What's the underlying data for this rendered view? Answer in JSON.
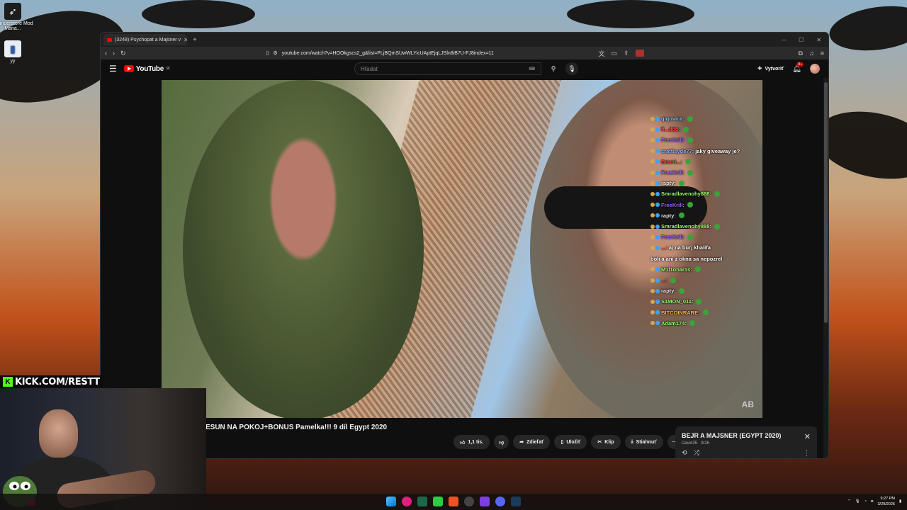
{
  "desktop": {
    "icons": [
      {
        "label": "Thunderstore Mod Mana..."
      },
      {
        "label": "yy"
      }
    ]
  },
  "browser": {
    "tab_title": "(3248) Psychopat a Majsner v",
    "address": "youtube.com/watch?v=HOOkgscs2_g&list=PLjBQmSUwWLYicUAptEjqLJSln8iB7U-FJ8index=11"
  },
  "youtube": {
    "logo_text": "YouTube",
    "logo_sup": "SK",
    "search_placeholder": "Hľadať",
    "create_label": "Vytvoriť",
    "notification_count": "9+",
    "video_title": "ESUN NA POKOJ+BONUS Pamelka!!! 9 díl Egypt 2020",
    "actions": {
      "like_count": "1,1 tis.",
      "share_label": "Zdieľať",
      "save_label": "Uložiť",
      "clip_label": "Klip",
      "download_label": "Stiahnuť"
    },
    "playlist": {
      "title": "BEJR A MAJSNER (EGYPT 2020)",
      "subtitle": "David35 · 9/26"
    },
    "watermark": "AB"
  },
  "chat": [
    {
      "user": "qiqovica:",
      "color": "#7ec8ff",
      "msg": ""
    },
    {
      "user": "fi...ddo:",
      "color": "#ff4040",
      "msg": ""
    },
    {
      "user": "FreeKrill:",
      "color": "#9b6bff",
      "msg": ""
    },
    {
      "user": "crattisyde77:",
      "color": "#8ab4ff",
      "msg": "jaky giveaway je?"
    },
    {
      "user": "Bmeri...:",
      "color": "#ff4040",
      "msg": ""
    },
    {
      "user": "FreeKrill:",
      "color": "#9b6bff",
      "msg": ""
    },
    {
      "user": "rapty:",
      "color": "#e8e8e8",
      "msg": ""
    },
    {
      "user": "Smradlavenohy888:",
      "color": "#9dff6a",
      "msg": ""
    },
    {
      "user": "FreeKrill:",
      "color": "#9b6bff",
      "msg": ""
    },
    {
      "user": "rapty:",
      "color": "#e8e8e8",
      "msg": ""
    },
    {
      "user": "Smradlavenohy888:",
      "color": "#9dff6a",
      "msg": ""
    },
    {
      "user": "FreeKrill:",
      "color": "#9b6bff",
      "msg": ""
    },
    {
      "user": "...:",
      "color": "#ff4040",
      "msg": "aj na burj khalifa"
    },
    {
      "user": "",
      "color": "#ffffff",
      "msg": "boli a ani z okna sa nepozrel"
    },
    {
      "user": "M1l1onar1s:",
      "color": "#9dff6a",
      "msg": ""
    },
    {
      "user": "...:",
      "color": "#ff4040",
      "msg": ""
    },
    {
      "user": "rapty:",
      "color": "#e8e8e8",
      "msg": ""
    },
    {
      "user": "S1MON_011:",
      "color": "#9dff6a",
      "msg": ""
    },
    {
      "user": "BITCOINRARE:",
      "color": "#ffb347",
      "msg": ""
    },
    {
      "user": "Adam174:",
      "color": "#9dff6a",
      "msg": ""
    }
  ],
  "stream": {
    "kick_banner": "KICK.COM/RESTT"
  },
  "taskbar": {
    "time": "9:27 PM",
    "date": "3/29/2026"
  }
}
